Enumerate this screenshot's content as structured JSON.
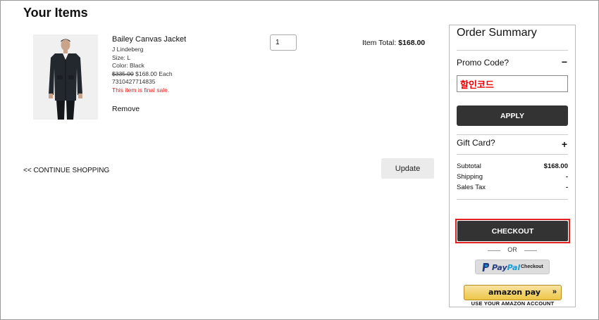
{
  "page": {
    "title": "Your Items"
  },
  "item": {
    "name": "Bailey Canvas Jacket",
    "brand": "J Lindeberg",
    "size": "Size: L",
    "color": "Color: Black",
    "original_price": "$335.00",
    "price": "$168.00 Each",
    "sku": "7310427714835",
    "final_sale_note": "This item is final sale.",
    "remove_label": "Remove",
    "quantity": "1",
    "total_label": "Item Total:",
    "total_value": "$168.00"
  },
  "actions": {
    "continue_label": "<< CONTINUE SHOPPING",
    "update_label": "Update"
  },
  "summary": {
    "title": "Order Summary",
    "promo_label": "Promo Code?",
    "promo_toggle": "−",
    "promo_value": "할인코드",
    "apply_label": "APPLY",
    "gift_label": "Gift Card?",
    "gift_toggle": "+",
    "subtotal_label": "Subtotal",
    "subtotal_value": "$168.00",
    "shipping_label": "Shipping",
    "shipping_value": "-",
    "tax_label": "Sales Tax",
    "tax_value": "-",
    "checkout_label": "CHECKOUT",
    "or_label": "OR",
    "paypal_word_1": "Pay",
    "paypal_word_2": "Pal",
    "paypal_checkout": "Checkout",
    "amazon_word": "amazon pay",
    "amazon_arrow": "»",
    "amazon_sub": "USE YOUR AMAZON ACCOUNT"
  },
  "colors": {
    "accent_red": "#e02020",
    "button_dark": "#333333",
    "paypal_navy": "#253b80",
    "paypal_blue": "#179bd7",
    "amazon_gold": "#eec646"
  },
  "icons": [
    "product-photo",
    "paypal-logo-icon",
    "amazon-arrow-icon"
  ]
}
